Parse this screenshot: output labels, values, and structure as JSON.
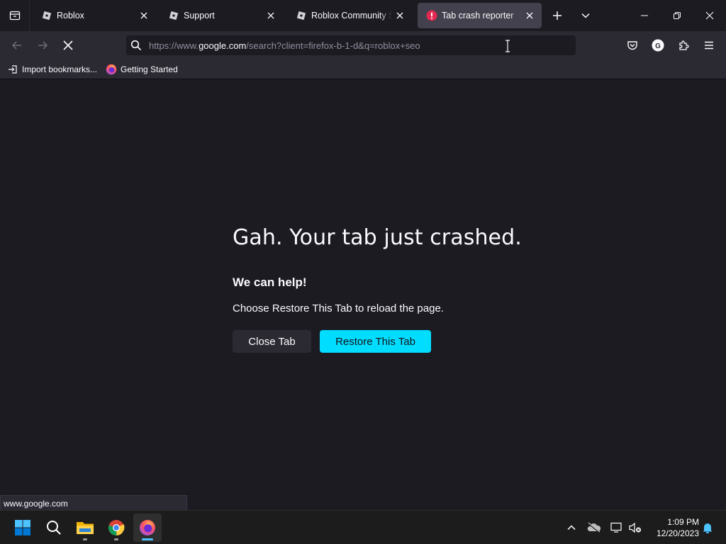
{
  "browser": {
    "tabs": [
      {
        "label": "Roblox",
        "active": false
      },
      {
        "label": "Support",
        "active": false
      },
      {
        "label": "Roblox Community Standards",
        "active": false
      },
      {
        "label": "Tab crash reporter",
        "active": true
      }
    ],
    "url_prefix": "https://www.",
    "url_host": "google.com",
    "url_rest": "/search?client=firefox-b-1-d&q=roblox+seo",
    "bookmarks": [
      {
        "label": "Import bookmarks...",
        "icon": "import-icon"
      },
      {
        "label": "Getting Started",
        "icon": "firefox-icon"
      }
    ],
    "account_initial": "G"
  },
  "crash": {
    "title": "Gah. Your tab just crashed.",
    "subtitle": "We can help!",
    "message": "Choose Restore This Tab to reload the page.",
    "close_label": "Close Tab",
    "restore_label": "Restore This Tab"
  },
  "status_text": "www.google.com",
  "taskbar": {
    "time": "1:09 PM",
    "date": "12/20/2023"
  },
  "colors": {
    "accent": "#00ddff",
    "background": "#1c1b22",
    "toolbar": "#2b2a33",
    "crash_icon": "#e22850"
  }
}
